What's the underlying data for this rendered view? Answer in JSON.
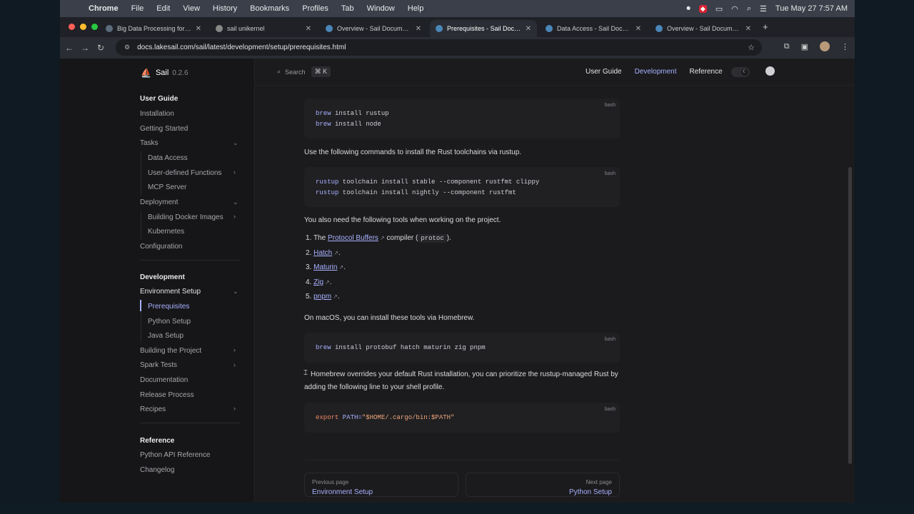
{
  "menubar": {
    "app": "Chrome",
    "items": [
      "File",
      "Edit",
      "View",
      "History",
      "Bookmarks",
      "Profiles",
      "Tab",
      "Window",
      "Help"
    ],
    "clock": "Tue May 27  7:57 AM"
  },
  "tabs": [
    {
      "title": "Big Data Processing for the A",
      "active": false
    },
    {
      "title": "sail unikernel",
      "active": false
    },
    {
      "title": "Overview - Sail Documentatio",
      "active": false
    },
    {
      "title": "Prerequisites - Sail Documen",
      "active": true
    },
    {
      "title": "Data Access - Sail Documenta",
      "active": false
    },
    {
      "title": "Overview - Sail Documentatio",
      "active": false
    }
  ],
  "address": {
    "url": "docs.lakesail.com/sail/latest/development/setup/prerequisites.html"
  },
  "brand": {
    "name": "Sail",
    "version": "0.2.6"
  },
  "search": {
    "label": "Search",
    "shortcut": "⌘ K"
  },
  "topnav": {
    "links": [
      "User Guide",
      "Development",
      "Reference"
    ],
    "active": "Development"
  },
  "sidebar": {
    "user_guide": "User Guide",
    "installation": "Installation",
    "getting_started": "Getting Started",
    "tasks": "Tasks",
    "data_access": "Data Access",
    "udf": "User-defined Functions",
    "mcp": "MCP Server",
    "deployment": "Deployment",
    "docker": "Building Docker Images",
    "kubernetes": "Kubernetes",
    "configuration": "Configuration",
    "development": "Development",
    "env_setup": "Environment Setup",
    "prerequisites": "Prerequisites",
    "python_setup": "Python Setup",
    "java_setup": "Java Setup",
    "building": "Building the Project",
    "spark_tests": "Spark Tests",
    "documentation": "Documentation",
    "release": "Release Process",
    "recipes": "Recipes",
    "reference": "Reference",
    "python_api": "Python API Reference",
    "changelog": "Changelog"
  },
  "content": {
    "code1": {
      "lang": "bash",
      "lines": [
        [
          "brew",
          " install rustup"
        ],
        [
          "brew",
          " install node"
        ]
      ]
    },
    "p1": "Use the following commands to install the Rust toolchains via rustup.",
    "code2": {
      "lang": "bash",
      "lines": [
        [
          "rustup",
          " toolchain install stable --component rustfmt clippy"
        ],
        [
          "rustup",
          " toolchain install nightly --component rustfmt"
        ]
      ]
    },
    "p2": "You also need the following tools when working on the project.",
    "list": {
      "n1": "1.",
      "n2": "2.",
      "n3": "3.",
      "n4": "4.",
      "n5": "5.",
      "item1_pre": "The ",
      "item1_link": "Protocol Buffers",
      "item1_mid": " compiler (",
      "item1_code": "protoc",
      "item1_post": ").",
      "item2": "Hatch",
      "item3": "Maturin",
      "item4": "Zig",
      "item5": "pnpm",
      "dot": "."
    },
    "p3": "On macOS, you can install these tools via Homebrew.",
    "code3": {
      "lang": "bash",
      "cmd": "brew",
      "rest": " install protobuf hatch maturin zig pnpm"
    },
    "p4": "Homebrew overrides your default Rust installation, you can prioritize the rustup-managed Rust by adding the following line to your shell profile.",
    "code4": {
      "lang": "bash",
      "kw": "export",
      "var": " PATH=",
      "str": "\"$HOME/.cargo/bin:$PATH\""
    }
  },
  "pager": {
    "prev_label": "Previous page",
    "prev": "Environment Setup",
    "next_label": "Next page",
    "next": "Python Setup"
  },
  "colors": {
    "accent": "#a8b1ff",
    "bg": "#1b1b1d",
    "sidebar": "#161618"
  }
}
